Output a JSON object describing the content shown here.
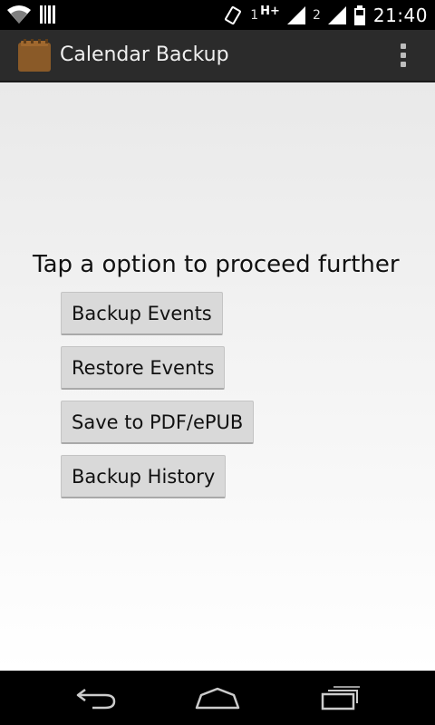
{
  "status_bar": {
    "time": "21:40",
    "sim1_label": "1",
    "sim1_network": "H+",
    "sim2_label": "2",
    "icons": [
      "wifi-icon",
      "barcode-icon",
      "vibrate-icon",
      "signal-icon",
      "battery-icon"
    ]
  },
  "action_bar": {
    "title": "Calendar Backup",
    "icon": "calendar-app-icon",
    "overflow_icon": "overflow-menu-icon"
  },
  "main": {
    "prompt": "Tap a option to proceed further",
    "buttons": [
      {
        "label": "Backup Events"
      },
      {
        "label": "Restore Events"
      },
      {
        "label": "Save to PDF/ePUB"
      },
      {
        "label": "Backup History"
      }
    ]
  },
  "nav_bar": {
    "icons": [
      "back-icon",
      "home-icon",
      "recent-apps-icon"
    ]
  }
}
